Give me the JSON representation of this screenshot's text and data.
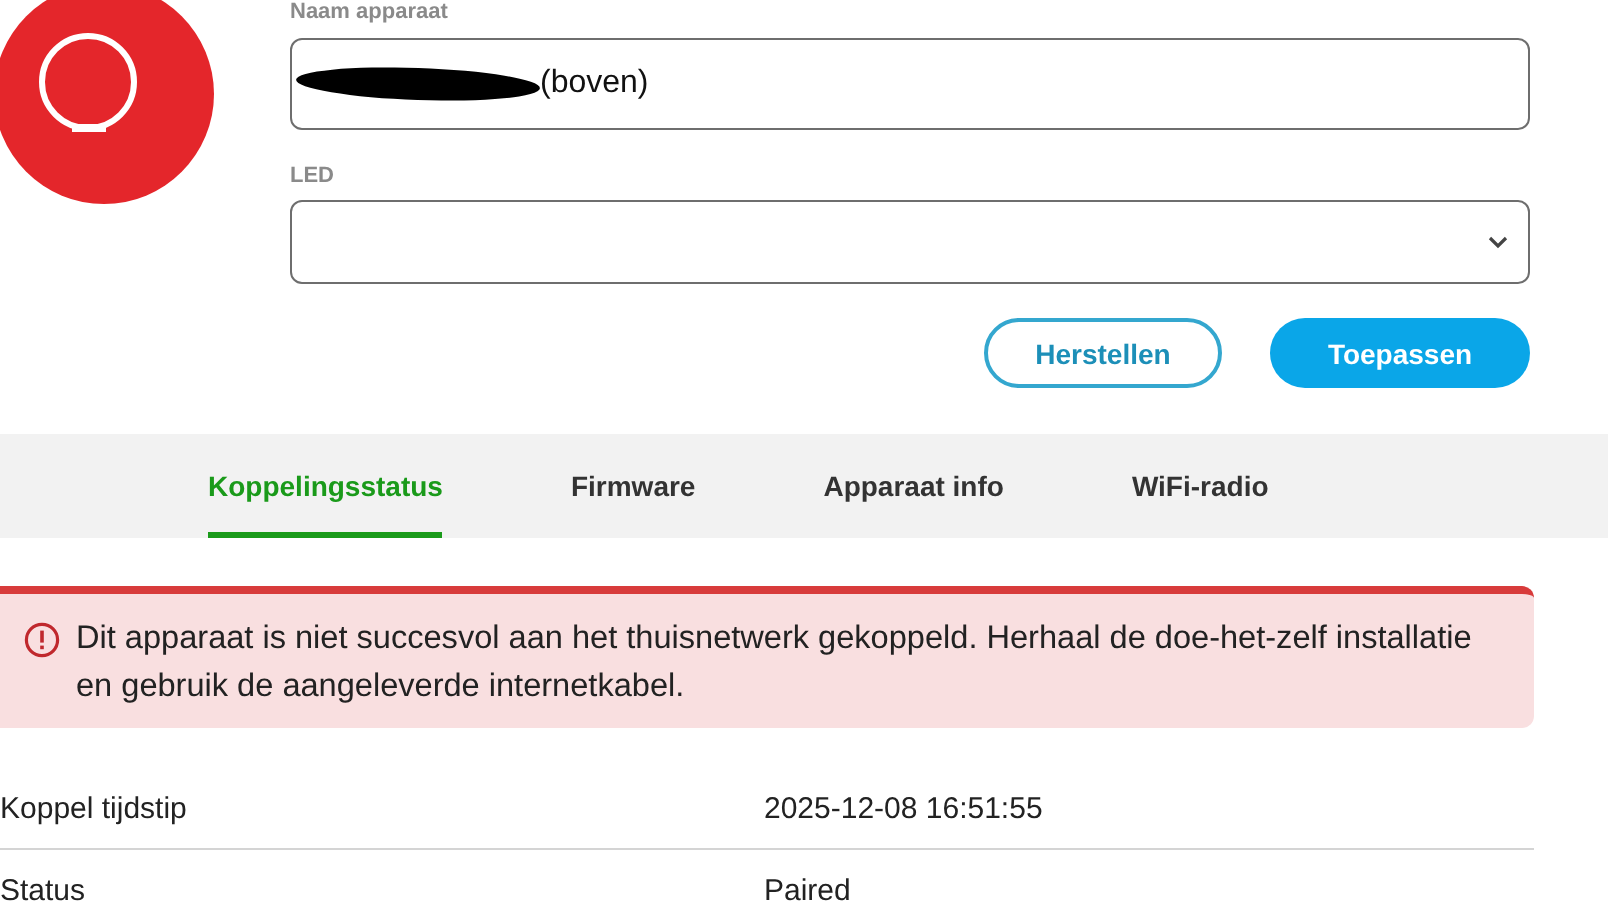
{
  "device": {
    "name_label": "Naam apparaat",
    "name_value": "(boven)",
    "name_redacted": true,
    "led_label": "LED"
  },
  "buttons": [
    {
      "label": "Herstellen",
      "kind": "secondary"
    },
    {
      "label": "Toepassen",
      "kind": "primary"
    }
  ],
  "tabs": [
    {
      "label": "Koppelingsstatus",
      "selected": true
    },
    {
      "label": "Firmware",
      "selected": false
    },
    {
      "label": "Apparaat info",
      "selected": false
    },
    {
      "label": "WiFi-radio",
      "selected": false
    }
  ],
  "alert": {
    "text": "Dit apparaat is niet succesvol aan het thuisnetwerk gekoppeld. Herhaal de doe-het-zelf installatie en gebruik de aangeleverde internetkabel."
  },
  "details": [
    {
      "label": "Koppel tijdstip",
      "value": "2025-12-08 16:51:55"
    },
    {
      "label": "Status",
      "value": "Paired"
    }
  ]
}
